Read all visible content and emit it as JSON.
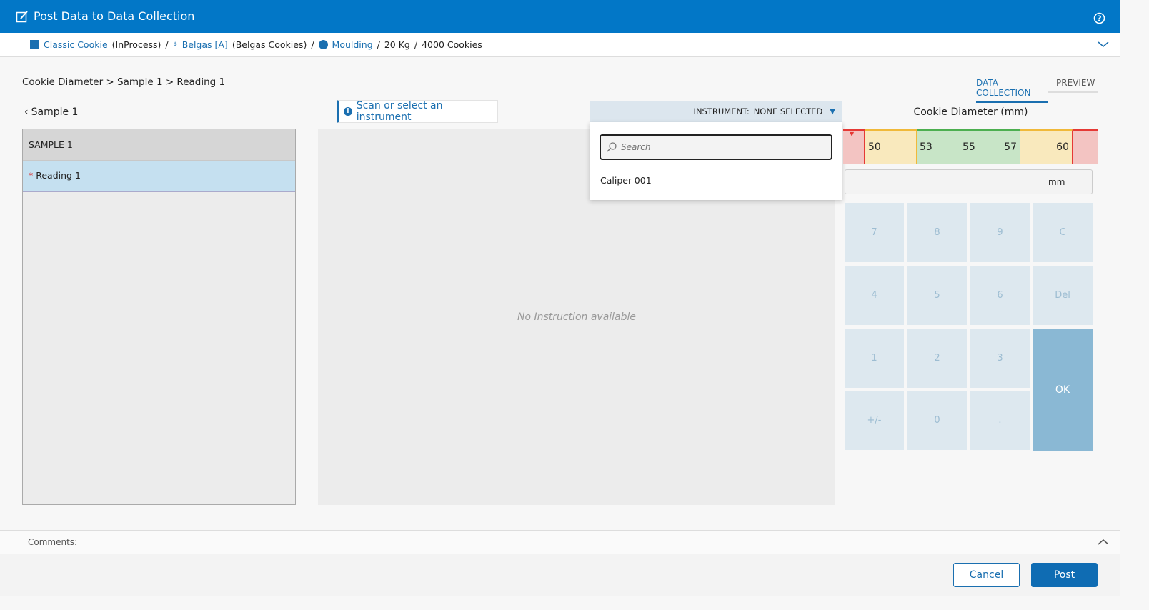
{
  "header": {
    "title": "Post Data to Data Collection",
    "edit_icon": "edit-icon",
    "help_icon": "help-icon"
  },
  "breadcrumb": {
    "product": "Classic Cookie",
    "product_state": "(InProcess)",
    "recipe": "Belgas [A]",
    "recipe_desc": "(Belgas Cookies)",
    "operation": "Moulding",
    "quantity": "20 Kg",
    "count": "4000 Cookies",
    "sep": "/"
  },
  "path": "Cookie Diameter > Sample 1 > Reading 1",
  "tabs": [
    {
      "label": "DATA COLLECTION",
      "active": true
    },
    {
      "label": "PREVIEW",
      "active": false
    }
  ],
  "back": {
    "label": "Sample 1"
  },
  "samples": {
    "group": "SAMPLE 1",
    "items": [
      {
        "label": "Reading 1",
        "required": "*"
      }
    ]
  },
  "instruction": {
    "banner": "Scan or select an instrument",
    "empty": "No Instruction available"
  },
  "instrument": {
    "label": "INSTRUMENT:",
    "value": "NONE SELECTED",
    "search_placeholder": "Search",
    "options": [
      "Caliper-001"
    ]
  },
  "measure": {
    "title": "Cookie Diameter (mm)",
    "unit": "mm",
    "value": "",
    "ticks": [
      "50",
      "53",
      "55",
      "57",
      "60"
    ],
    "colors": {
      "red": "#f3c4c2",
      "yellow": "#f9e9bd",
      "green": "#c8e5c7"
    }
  },
  "keypad": [
    "7",
    "8",
    "9",
    "C",
    "4",
    "5",
    "6",
    "Del",
    "1",
    "2",
    "3",
    "+/-",
    "0",
    "."
  ],
  "ok": "OK",
  "comments": {
    "label": "Comments:"
  },
  "footer": {
    "cancel": "Cancel",
    "post": "Post"
  }
}
